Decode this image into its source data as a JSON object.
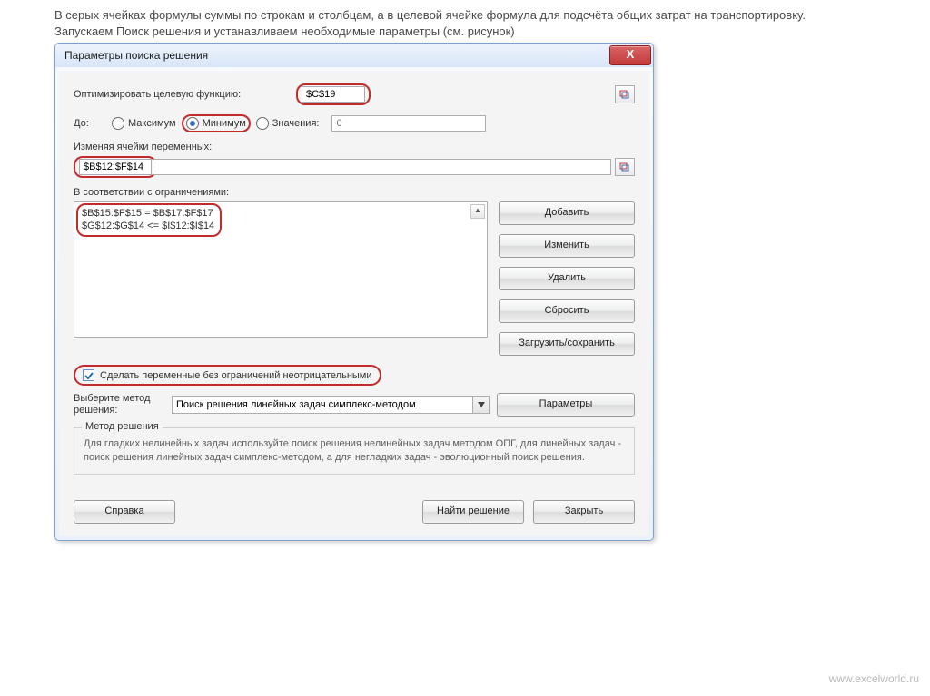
{
  "page": {
    "intro1": "В серых ячейках формулы суммы по строкам и столбцам, а в целевой ячейке формула для подсчёта общих затрат на транспортировку.",
    "intro2": "Запускаем Поиск решения и устанавливаем необходимые параметры (см. рисунок)"
  },
  "dialog": {
    "title": "Параметры поиска решения",
    "close": "X",
    "objective_label": "Оптимизировать целевую функцию:",
    "objective_value": "$C$19",
    "to_label": "До:",
    "opt_max": "Максимум",
    "opt_min": "Минимум",
    "opt_val": "Значения:",
    "opt_val_num": "0",
    "vars_label": "Изменяя ячейки переменных:",
    "vars_value": "$B$12:$F$14",
    "constraints_label": "В соответствии с ограничениями:",
    "constraints": [
      "$B$15:$F$15 = $B$17:$F$17",
      "$G$12:$G$14 <= $I$12:$I$14"
    ],
    "btn_add": "Добавить",
    "btn_change": "Изменить",
    "btn_delete": "Удалить",
    "btn_reset": "Сбросить",
    "btn_loadsave": "Загрузить/сохранить",
    "chk_nonneg": "Сделать переменные без ограничений неотрицательными",
    "method_label": "Выберите метод решения:",
    "method_value": "Поиск решения линейных задач симплекс-методом",
    "btn_params": "Параметры",
    "group_title": "Метод решения",
    "group_desc": "Для гладких нелинейных задач используйте поиск решения нелинейных задач методом ОПГ, для линейных задач - поиск решения линейных задач симплекс-методом, а для негладких задач - эволюционный поиск решения.",
    "btn_help": "Справка",
    "btn_solve": "Найти решение",
    "btn_close": "Закрыть"
  },
  "credit": "www.excelworld.ru"
}
